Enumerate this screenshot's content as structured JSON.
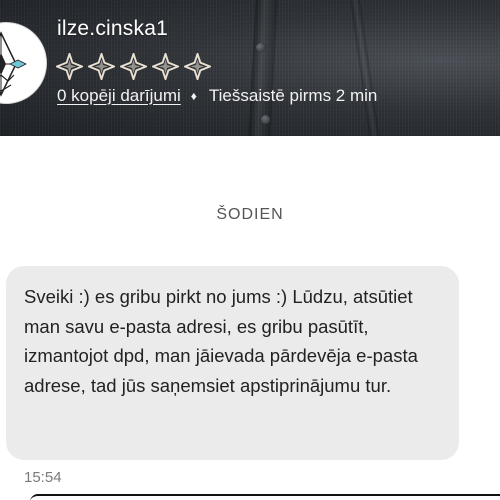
{
  "header": {
    "username": "ilze.cinska1",
    "rating_icon": "star-outline-icon",
    "rating_count": 5,
    "transactions_link": "0 kopēji darījumi",
    "separator_icon": "diamond-separator-icon",
    "separator_glyph": "♦",
    "online_status": "Tiešsaistē pirms 2 min"
  },
  "chat": {
    "date_label": "ŠODIEN",
    "messages": [
      {
        "text": "Sveiki :) es gribu pirkt no jums :) Lūdzu, atsūtiet man savu e-pasta adresi, es gribu pasūtīt, izmantojot dpd, man jāievada pārdevēja e-pasta adrese, tad jūs saņemsiet apstiprinājumu tur.",
        "time": "15:54"
      }
    ]
  },
  "colors": {
    "bubble_bg": "#ebebeb",
    "header_text": "#ffffff",
    "date_text": "#555555",
    "time_text": "#7a7a7a"
  }
}
